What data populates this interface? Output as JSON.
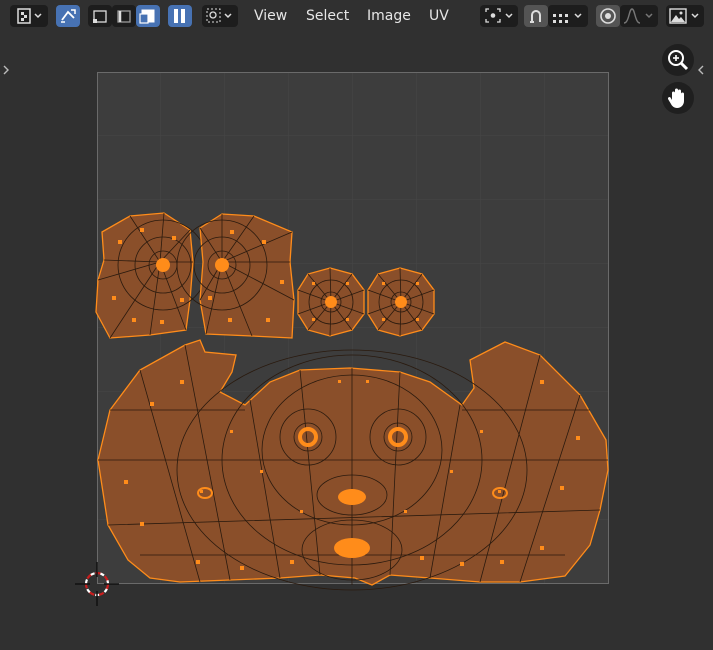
{
  "header": {
    "menus": [
      "View",
      "Select",
      "Image",
      "UV"
    ],
    "editor_type_icon": "uv-editor-icon",
    "sync_selection_icon": "sync-selection-icon",
    "select_modes": [
      "vertex-mode-icon",
      "edge-mode-icon",
      "face-mode-icon",
      "island-mode-icon"
    ],
    "sticky_select_icon": "sticky-select-icon",
    "pivot_icon": "pivot-point-icon",
    "snap_icon": "snap-icon",
    "snap_target_icon": "snap-increment-icon",
    "proportional_icon": "proportional-edit-icon",
    "falloff_icon": "falloff-curve-icon",
    "image_browse_icon": "image-browse-icon"
  },
  "navigation": {
    "zoom_icon": "zoom-icon",
    "pan_icon": "hand-icon"
  },
  "colors": {
    "background": "#303030",
    "grid_fill": "#3d3d3d",
    "grid_line": "#4a4a4a",
    "uv_face": "#8a4f2a",
    "uv_edge": "#ff8c1a",
    "uv_seam_edge": "#2a1a0e",
    "active_blue": "#4772b3",
    "cursor_red": "#c81e1e"
  }
}
